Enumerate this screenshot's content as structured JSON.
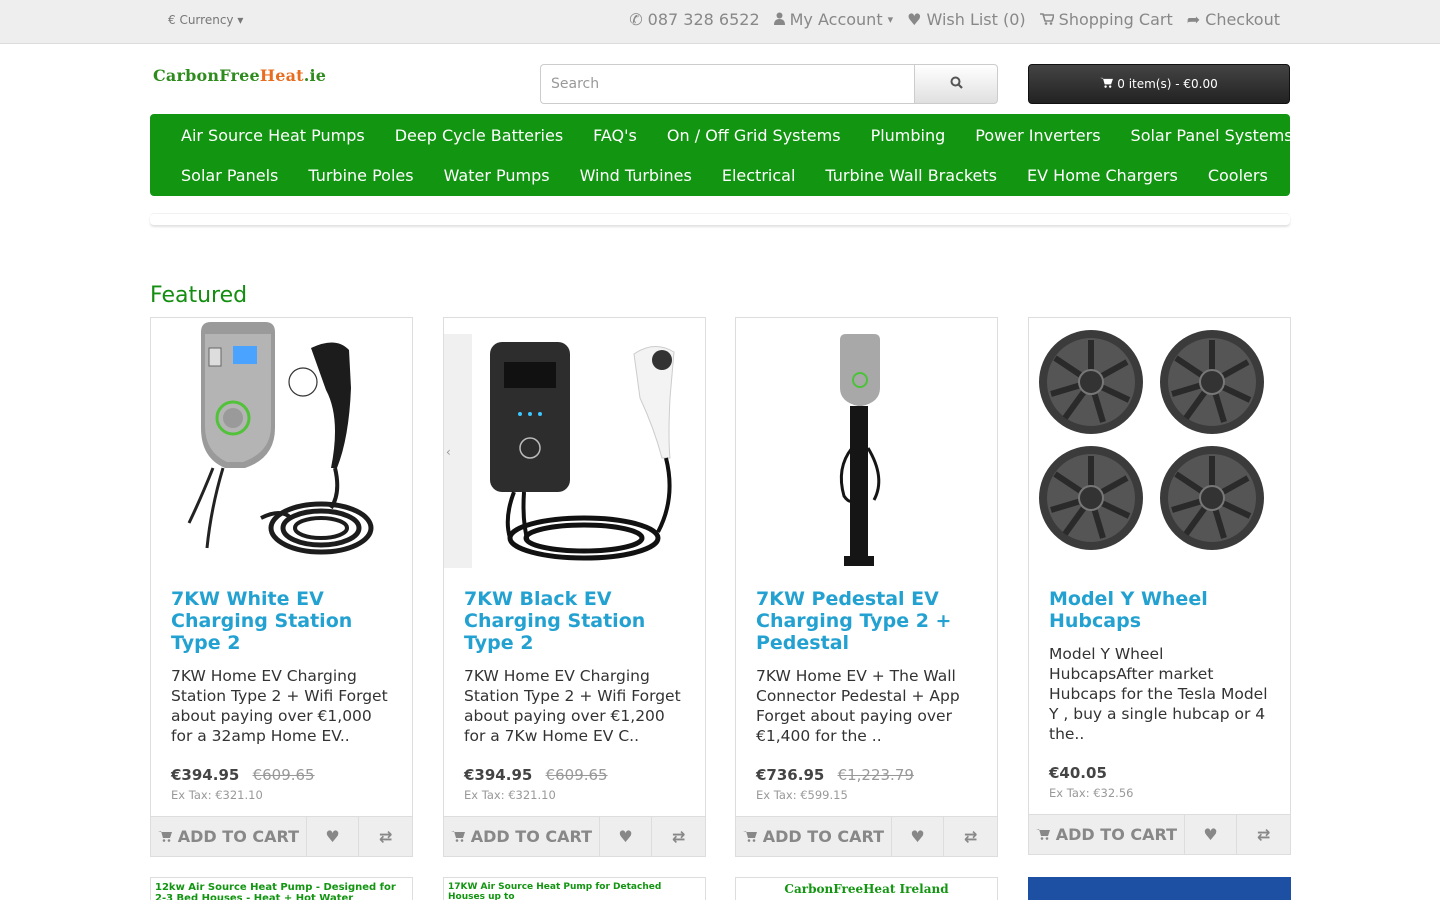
{
  "topbar": {
    "currency_label": "€ Currency",
    "phone": "087 328 6522",
    "my_account": "My Account",
    "wish_list": "Wish List (0)",
    "shopping_cart": "Shopping Cart",
    "checkout": "Checkout"
  },
  "header": {
    "logo_part1": "CarbonFree",
    "logo_part2": "Heat",
    "logo_part3": ".ie",
    "search_placeholder": "Search",
    "cart_summary": "0 item(s) - €0.00"
  },
  "menu": {
    "row1": [
      "Air Source Heat Pumps",
      "Deep Cycle Batteries",
      "FAQ's",
      "On / Off Grid Systems",
      "Plumbing",
      "Power Inverters",
      "Solar Panel Systems"
    ],
    "row2": [
      "Solar Panels",
      "Turbine Poles",
      "Water Pumps",
      "Wind Turbines",
      "Electrical",
      "Turbine Wall Brackets",
      "EV Home Chargers",
      "Coolers"
    ]
  },
  "featured": {
    "heading": "Featured",
    "add_to_cart": "ADD TO CART",
    "products": [
      {
        "name": "7KW White EV Charging Station Type 2",
        "description": "7KW Home EV Charging Station Type 2 + Wifi  Forget about paying over €1,000 for a 32amp Home EV..",
        "price": "€394.95",
        "old_price": "€609.65",
        "ex_tax": "Ex Tax: €321.10"
      },
      {
        "name": "7KW Black EV Charging Station Type 2",
        "description": "7KW Home EV Charging Station Type 2 + Wifi  Forget about paying over €1,200 for a 7Kw Home EV C..",
        "price": "€394.95",
        "old_price": "€609.65",
        "ex_tax": "Ex Tax: €321.10"
      },
      {
        "name": "7KW Pedestal EV Charging Type 2 + Pedestal",
        "description": "7KW Home EV + The Wall Connector Pedestal + App  Forget about paying over €1,400 for the  ..",
        "price": "€736.95",
        "old_price": "€1,223.79",
        "ex_tax": "Ex Tax: €599.15"
      },
      {
        "name": "Model Y Wheel Hubcaps",
        "description": "Model Y Wheel HubcapsAfter market Hubcaps for the Tesla Model Y , buy a single hubcap or 4  the..",
        "price": "€40.05",
        "old_price": "",
        "ex_tax": "Ex Tax: €32.56"
      }
    ],
    "next_row_banners": [
      "12kw Air Source Heat Pump - Designed for 2-3 Bed Houses - Heat + Hot Water",
      "17KW Air Source Heat Pump for Detached Houses up to",
      "CarbonFreeHeat Ireland",
      ""
    ]
  },
  "colors": {
    "menu_green": "#129511",
    "link_blue": "#23a1d1",
    "heading_green": "#138e10"
  }
}
